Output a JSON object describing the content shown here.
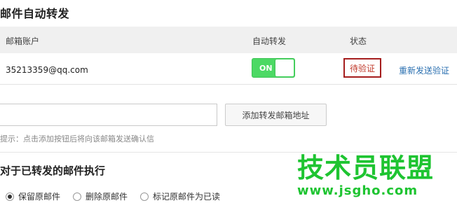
{
  "page": {
    "title": "邮件自动转发"
  },
  "table": {
    "headers": {
      "account": "邮箱账户",
      "auto_forward": "自动转发",
      "status": "状态"
    },
    "rows": [
      {
        "account": "35213359@qq.com",
        "toggle_label": "ON",
        "status": "待验证",
        "action": "重新发送验证"
      }
    ]
  },
  "add_forward": {
    "input_value": "",
    "input_placeholder": "",
    "button_label": "添加转发邮箱地址",
    "hint": "提示：点击添加按钮后将向该邮箱发送确认信"
  },
  "forwarded_action": {
    "title": "对于已转发的邮件执行",
    "options": [
      {
        "label": "保留原邮件",
        "selected": true
      },
      {
        "label": "删除原邮件",
        "selected": false
      },
      {
        "label": "标记原邮件为已读",
        "selected": false
      }
    ]
  },
  "watermark": {
    "text": "技术员联盟",
    "url": "www.jsgho.com"
  },
  "colors": {
    "toggle_on": "#4cd964",
    "status_border": "#a51d1d",
    "link": "#2a6fb0",
    "watermark": "#1ec431"
  }
}
